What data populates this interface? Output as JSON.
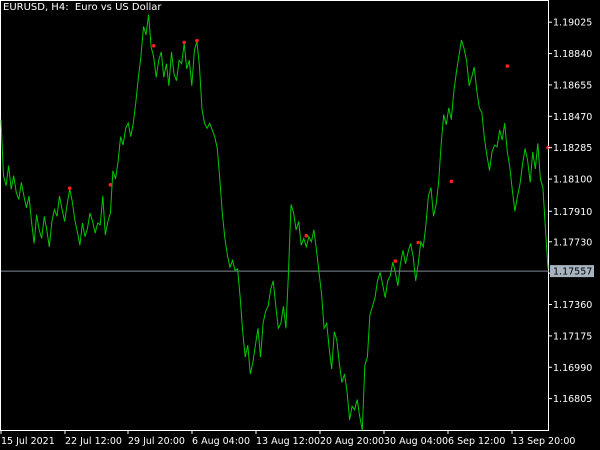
{
  "window": {
    "title": "EURUSD, H4:  Euro vs US Dollar"
  },
  "colors": {
    "background": "#000000",
    "frame": "#ffffff",
    "line": "#00c800",
    "marker": "#ff2020",
    "current_price_line": "#7f8a94",
    "current_price_tag_bg": "#a8b4c0"
  },
  "chart_data": {
    "type": "line",
    "title": "EURUSD, H4:  Euro vs US Dollar",
    "xlabel": "",
    "ylabel": "",
    "ylim": [
      1.1662,
      1.1915
    ],
    "grid": false,
    "y_ticks": [
      "1.19025",
      "1.18840",
      "1.18655",
      "1.18470",
      "1.18285",
      "1.18100",
      "1.17910",
      "1.17730",
      "1.17545",
      "1.17360",
      "1.17175",
      "1.16990",
      "1.16805"
    ],
    "x_ticks": [
      "15 Jul 2021",
      "22 Jul 12:00",
      "29 Jul 20:00",
      "6 Aug 04:00",
      "13 Aug 12:00",
      "20 Aug 20:00",
      "30 Aug 04:00",
      "6 Sep 12:00",
      "13 Sep 20:00"
    ],
    "current_price": 1.17557,
    "current_price_label": "1.17557",
    "series": [
      {
        "values": [
          1.1845,
          1.1812,
          1.1806,
          1.1818,
          1.1804,
          1.1812,
          1.1802,
          1.1798,
          1.1808,
          1.18,
          1.1793,
          1.18,
          1.1785,
          1.1772,
          1.1789,
          1.178,
          1.1775,
          1.1788,
          1.178,
          1.177,
          1.1785,
          1.1792,
          1.1788,
          1.18,
          1.1792,
          1.1785,
          1.1795,
          1.1804,
          1.1797,
          1.1786,
          1.1779,
          1.1771,
          1.1784,
          1.1776,
          1.1781,
          1.179,
          1.1785,
          1.1778,
          1.1784,
          1.1783,
          1.18,
          1.1777,
          1.1785,
          1.179,
          1.1815,
          1.181,
          1.182,
          1.1835,
          1.183,
          1.184,
          1.1843,
          1.1835,
          1.1843,
          1.1855,
          1.187,
          1.1882,
          1.19,
          1.1895,
          1.1907,
          1.1888,
          1.1882,
          1.187,
          1.188,
          1.1885,
          1.187,
          1.1878,
          1.1865,
          1.1885,
          1.1872,
          1.1868,
          1.188,
          1.1878,
          1.189,
          1.1875,
          1.188,
          1.1865,
          1.1886,
          1.1891,
          1.1877,
          1.1851,
          1.1843,
          1.184,
          1.1843,
          1.1839,
          1.1835,
          1.1828,
          1.181,
          1.179,
          1.1775,
          1.1765,
          1.1758,
          1.1762,
          1.1756,
          1.1757,
          1.174,
          1.172,
          1.1705,
          1.1712,
          1.1695,
          1.1702,
          1.1712,
          1.1722,
          1.1705,
          1.1725,
          1.1732,
          1.1735,
          1.1745,
          1.175,
          1.1735,
          1.1722,
          1.1725,
          1.1735,
          1.1722,
          1.1755,
          1.1795,
          1.179,
          1.178,
          1.1785,
          1.1771,
          1.1775,
          1.177,
          1.1776,
          1.1773,
          1.178,
          1.1768,
          1.1755,
          1.1742,
          1.1722,
          1.1725,
          1.171,
          1.1698,
          1.172,
          1.1715,
          1.1701,
          1.169,
          1.1695,
          1.1685,
          1.1668,
          1.1676,
          1.1674,
          1.168,
          1.167,
          1.1662,
          1.17,
          1.1705,
          1.173,
          1.1735,
          1.174,
          1.175,
          1.1755,
          1.1748,
          1.174,
          1.175,
          1.1753,
          1.1761,
          1.1755,
          1.1747,
          1.176,
          1.1768,
          1.176,
          1.1767,
          1.1772,
          1.1764,
          1.175,
          1.176,
          1.1773,
          1.177,
          1.1783,
          1.18,
          1.1805,
          1.1788,
          1.1795,
          1.1808,
          1.183,
          1.1848,
          1.1842,
          1.1852,
          1.1845,
          1.1862,
          1.1873,
          1.1883,
          1.1892,
          1.1887,
          1.188,
          1.1865,
          1.187,
          1.1876,
          1.1862,
          1.1852,
          1.1849,
          1.1834,
          1.1824,
          1.1815,
          1.1826,
          1.183,
          1.1829,
          1.1839,
          1.1833,
          1.1843,
          1.1826,
          1.1817,
          1.1803,
          1.1791,
          1.18,
          1.1807,
          1.1819,
          1.1828,
          1.1821,
          1.1808,
          1.1826,
          1.1816,
          1.1831,
          1.181,
          1.1805,
          1.178,
          1.1757
        ]
      }
    ],
    "markers": [
      {
        "index": 27,
        "value": 1.1804
      },
      {
        "index": 43,
        "value": 1.1806
      },
      {
        "index": 60,
        "value": 1.1888
      },
      {
        "index": 72,
        "value": 1.189
      },
      {
        "index": 77,
        "value": 1.1891
      },
      {
        "index": 120,
        "value": 1.1776
      },
      {
        "index": 155,
        "value": 1.1761
      },
      {
        "index": 164,
        "value": 1.1772
      },
      {
        "index": 177,
        "value": 1.1808
      },
      {
        "index": 199,
        "value": 1.1876
      },
      {
        "index": 215,
        "value": 1.1828
      }
    ]
  }
}
